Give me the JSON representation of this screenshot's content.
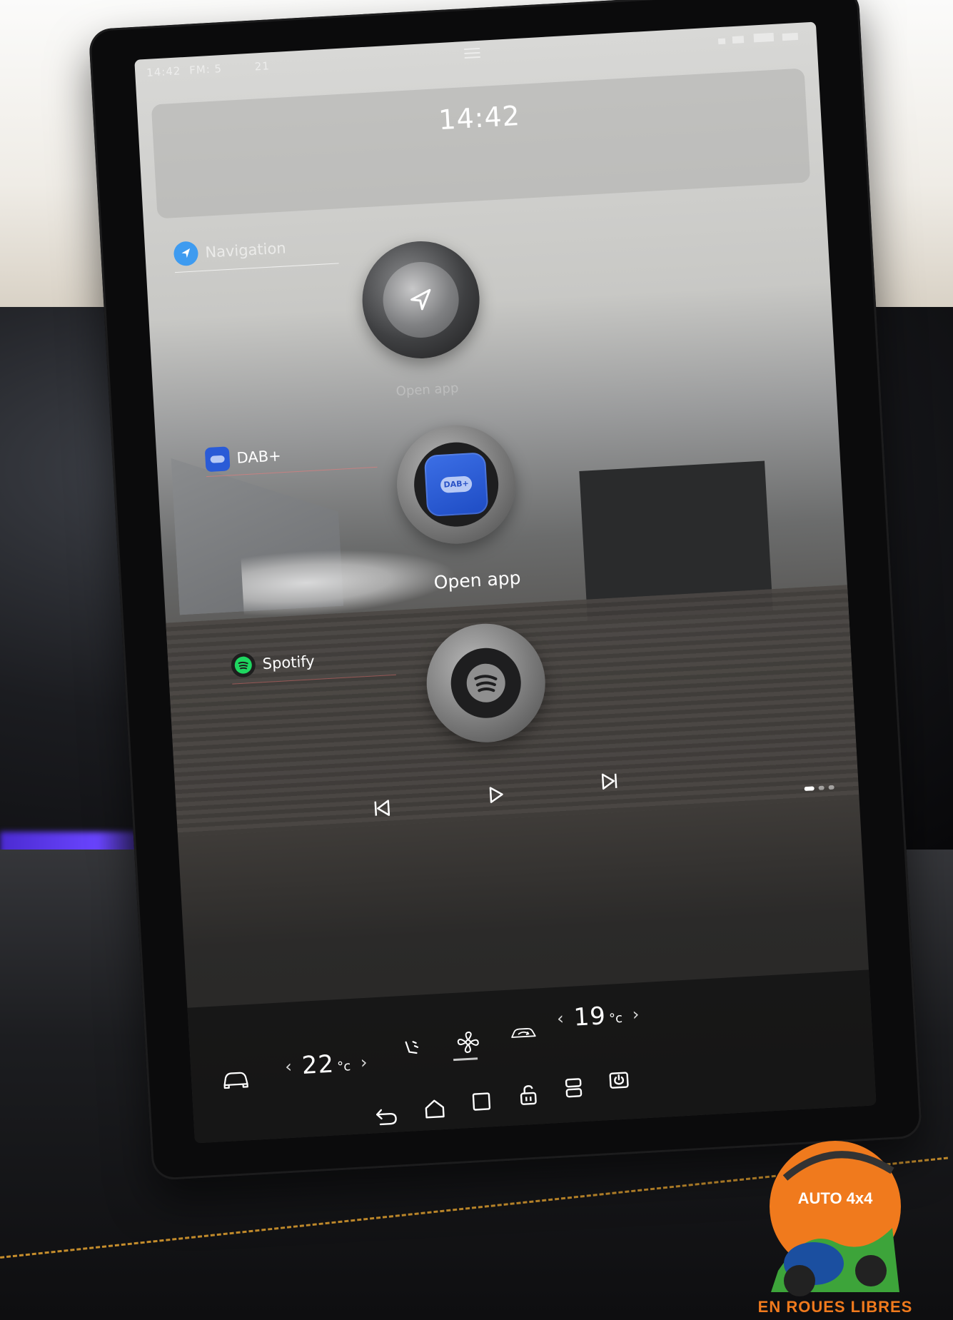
{
  "status_bar": {
    "time": "14:42",
    "left_extra": "FM: 5",
    "left_extra2": "21",
    "center_icon": "menu-icon"
  },
  "clock": {
    "time": "14:42"
  },
  "widgets": {
    "navigation": {
      "label": "Navigation",
      "icon": "navigation-arrow-icon"
    },
    "dab": {
      "label": "DAB+",
      "tile_text": "DAB+",
      "icon": "radio-icon",
      "action_label": "Open app",
      "faint_label": "Open app"
    },
    "spotify": {
      "label": "Spotify",
      "icon": "spotify-icon"
    }
  },
  "media_controls": {
    "previous": "skip-previous-icon",
    "play": "play-icon",
    "next": "skip-next-icon"
  },
  "climate": {
    "driver_temp": "22",
    "passenger_temp": "19",
    "unit": "°c",
    "icons": [
      "car-icon",
      "seat-airflow-icon",
      "fan-icon",
      "recirculation-icon"
    ]
  },
  "system_nav": {
    "icons": [
      "back-icon",
      "home-icon",
      "recents-icon",
      "lock-icon",
      "split-screen-icon",
      "power-icon"
    ]
  },
  "watermark": {
    "brand": "AUTO 4x4",
    "tagline": "EN ROUES LIBRES"
  },
  "colors": {
    "dab_blue": "#2a5bd7",
    "spotify_green": "#1ed760",
    "navigation_blue": "#3e9bf0",
    "watermark_orange": "#f07a1d"
  }
}
